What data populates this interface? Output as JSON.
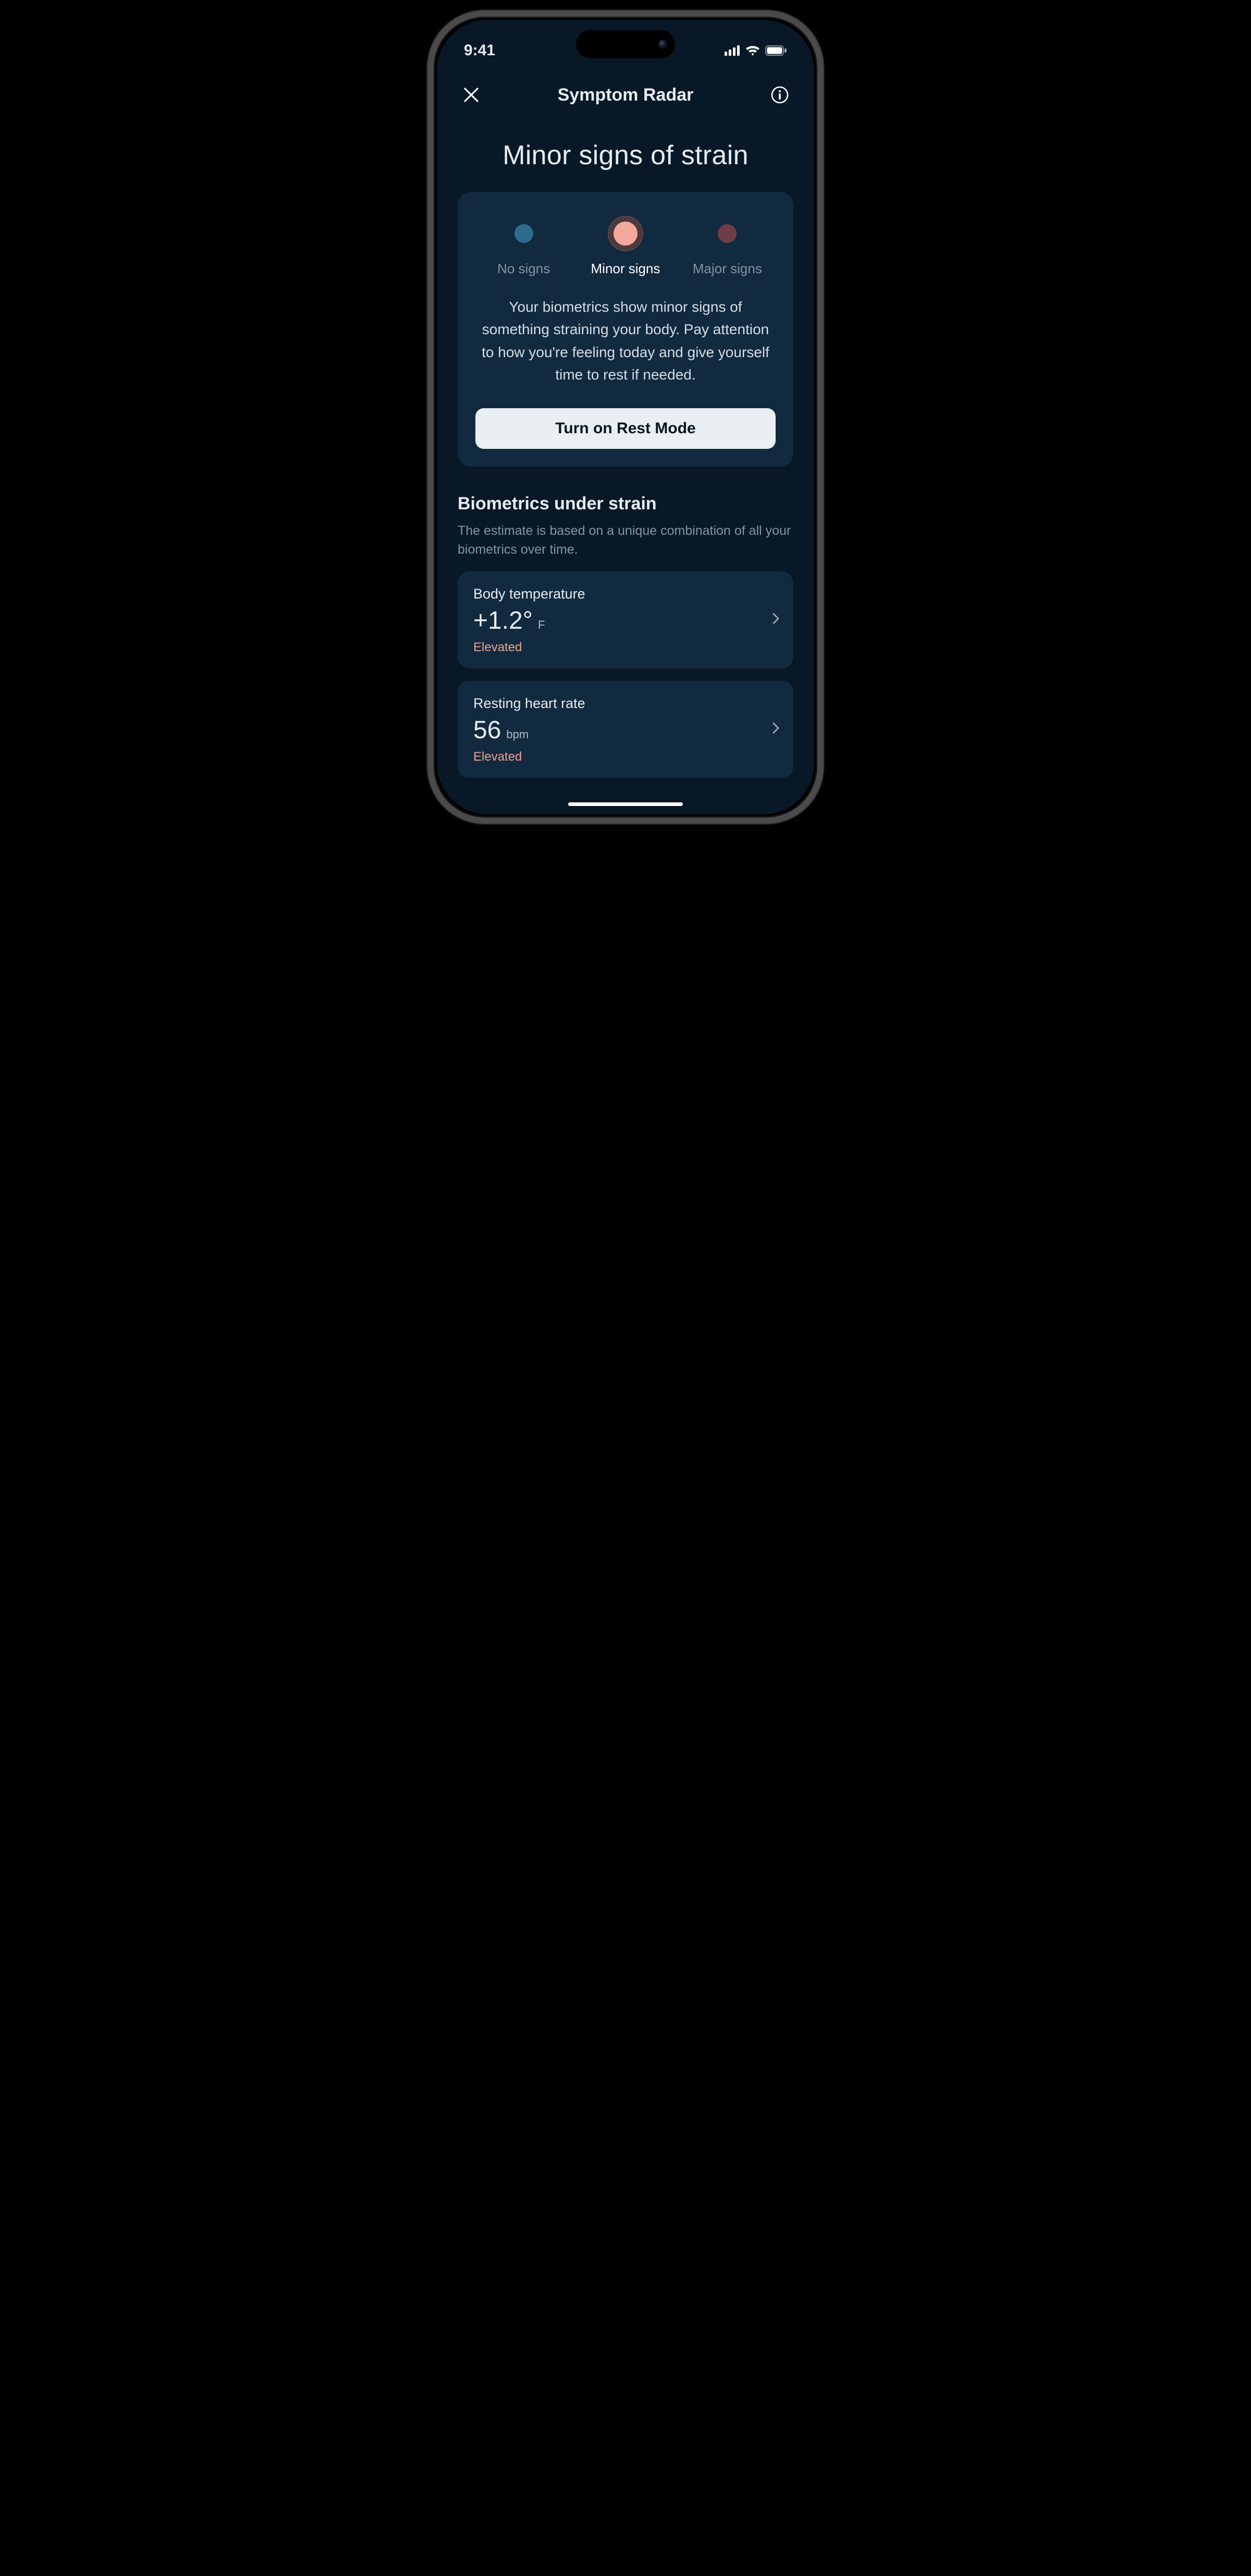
{
  "status": {
    "time": "9:41"
  },
  "nav": {
    "title": "Symptom Radar"
  },
  "hero": {
    "title": "Minor signs of strain"
  },
  "levels": {
    "none": "No signs",
    "minor": "Minor signs",
    "major": "Major signs"
  },
  "card": {
    "description": "Your biometrics show minor signs of something straining your body. Pay attention to how you're feeling today and give yourself time to rest if needed.",
    "rest_button": "Turn on Rest Mode"
  },
  "section": {
    "title": "Biometrics under strain",
    "description": "The estimate is based on a unique combination of all your biometrics over time."
  },
  "metrics": {
    "temp": {
      "label": "Body temperature",
      "value": "+1.2°",
      "unit": "F",
      "status": "Elevated"
    },
    "rhr": {
      "label": "Resting heart rate",
      "value": "56",
      "unit": "bpm",
      "status": "Elevated"
    }
  }
}
